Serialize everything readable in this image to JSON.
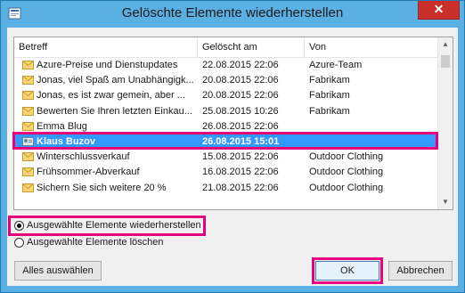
{
  "window": {
    "title": "Gelöschte Elemente wiederherstellen",
    "close_glyph": "✕"
  },
  "columns": [
    "Betreff",
    "Gelöscht am",
    "Von"
  ],
  "rows": [
    {
      "subject": "Azure-Preise und Dienstupdates",
      "deleted": "22.08.2015 22:06",
      "from": "Azure-Team",
      "icon": "envelope-icon"
    },
    {
      "subject": "Jonas, viel Spaß am Unabhängigk...",
      "deleted": "20.08.2015 22:06",
      "from": "Fabrikam",
      "icon": "envelope-icon"
    },
    {
      "subject": "Jonas, es ist zwar gemein, aber ...",
      "deleted": "20.08.2015 22:06",
      "from": "Fabrikam",
      "icon": "envelope-icon"
    },
    {
      "subject": "Bewerten Sie Ihren letzten Einkau...",
      "deleted": "25.08.2015 10:26",
      "from": "Fabrikam",
      "icon": "envelope-icon"
    },
    {
      "subject": "Emma Blug",
      "deleted": "26.08.2015 22:06",
      "from": "",
      "icon": "envelope-icon"
    },
    {
      "subject": "Klaus Buzov",
      "deleted": "26.08.2015 15:01",
      "from": "",
      "icon": "contact-icon",
      "selected": true
    },
    {
      "subject": "Winterschlussverkauf",
      "deleted": "15.08.2015 22:06",
      "from": "Outdoor Clothing",
      "icon": "envelope-icon"
    },
    {
      "subject": "Frühsommer-Abverkauf",
      "deleted": "16.08.2015 22:06",
      "from": "Outdoor Clothing",
      "icon": "envelope-icon"
    },
    {
      "subject": "Sichern Sie sich weitere 20 %",
      "deleted": "21.08.2015 22:06",
      "from": "Outdoor Clothing",
      "icon": "envelope-icon"
    }
  ],
  "options": {
    "restore_label": "Ausgewählte Elemente wiederherstellen",
    "delete_label": "Ausgewählte Elemente löschen",
    "selected": "restore"
  },
  "buttons": {
    "select_all": "Alles auswählen",
    "ok": "OK",
    "cancel": "Abbrechen"
  },
  "colors": {
    "selection": "#3399ff",
    "highlight": "#e6007e",
    "titlebar": "#5bb0e3",
    "close": "#c9302c"
  }
}
